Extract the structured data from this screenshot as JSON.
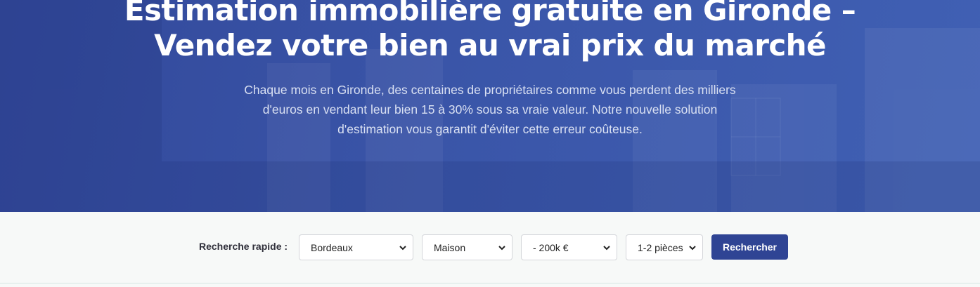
{
  "hero": {
    "title_line1": "Estimation immobilière gratuite en Gironde –",
    "title_line2": "Vendez votre bien au vrai prix du marché",
    "text_line1": "Chaque mois en Gironde, des centaines de propriétaires comme vous perdent des milliers",
    "text_line2": "d'euros en vendant leur bien 15 à 30% sous sa vraie valeur. Notre nouvelle solution",
    "text_line3": "d'estimation vous garantit d'éviter cette erreur coûteuse."
  },
  "search": {
    "label": "Recherche rapide :",
    "city": "Bordeaux",
    "type": "Maison",
    "budget": "- 200k €",
    "rooms": "1-2 pièces",
    "submit": "Rechercher"
  },
  "icons": {
    "select_arrow": "chevron-down-icon"
  },
  "colors": {
    "hero_bg": "#3a55a8",
    "button_bg": "#2f4494",
    "page_bg": "#f7f9f8"
  }
}
